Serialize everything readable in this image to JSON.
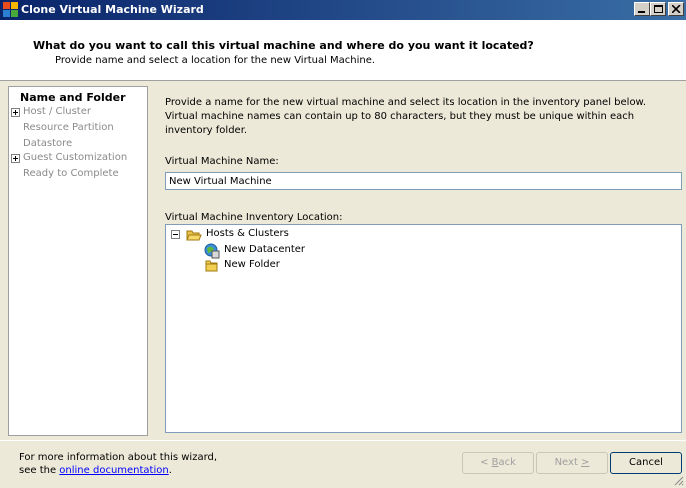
{
  "window": {
    "title": "Clone Virtual Machine Wizard",
    "controls": [
      "minimize",
      "maximize",
      "close"
    ]
  },
  "header": {
    "title": "What do you want to call this virtual machine and where do you want it located?",
    "subtitle": "Provide name and select a location for the new Virtual Machine."
  },
  "steps": [
    {
      "label": "Name and Folder",
      "state": "active",
      "expandable": false
    },
    {
      "label": "Host / Cluster",
      "state": "inactive",
      "expandable": true
    },
    {
      "label": "Resource Partition",
      "state": "inactive",
      "expandable": false
    },
    {
      "label": "Datastore",
      "state": "inactive",
      "expandable": false
    },
    {
      "label": "Guest Customization",
      "state": "inactive",
      "expandable": true
    },
    {
      "label": "Ready to Complete",
      "state": "inactive",
      "expandable": false
    }
  ],
  "content": {
    "description": "Provide a name for the new virtual machine and select its location in the inventory panel below. Virtual machine names can contain up to 80 characters, but they must be unique within each inventory folder.",
    "name_label": "Virtual Machine Name:",
    "name_value": "New Virtual Machine",
    "inventory_label": "Virtual Machine Inventory Location:",
    "tree": [
      {
        "label": "Hosts & Clusters",
        "icon": "open-folder-icon",
        "expanded": true
      },
      {
        "label": "New Datacenter",
        "icon": "datacenter-icon"
      },
      {
        "label": "New Folder",
        "icon": "folder-icon"
      }
    ]
  },
  "footer": {
    "info_text_1": "For more information about this wizard,",
    "info_text_2": "see the",
    "link_text": "online documentation",
    "info_text_end": ".",
    "back_label_accel": "B",
    "back_label_rest": "ack",
    "back_prefix": "< ",
    "next_label": "Next ",
    "next_accel": ">",
    "cancel_label": "Cancel"
  },
  "colors": {
    "titlebar_start": "#0a246a",
    "titlebar_end": "#3a6ea5",
    "dialog_bg": "#ece9d8",
    "link": "#0000ff",
    "disabled_text": "#8a8a8a"
  }
}
